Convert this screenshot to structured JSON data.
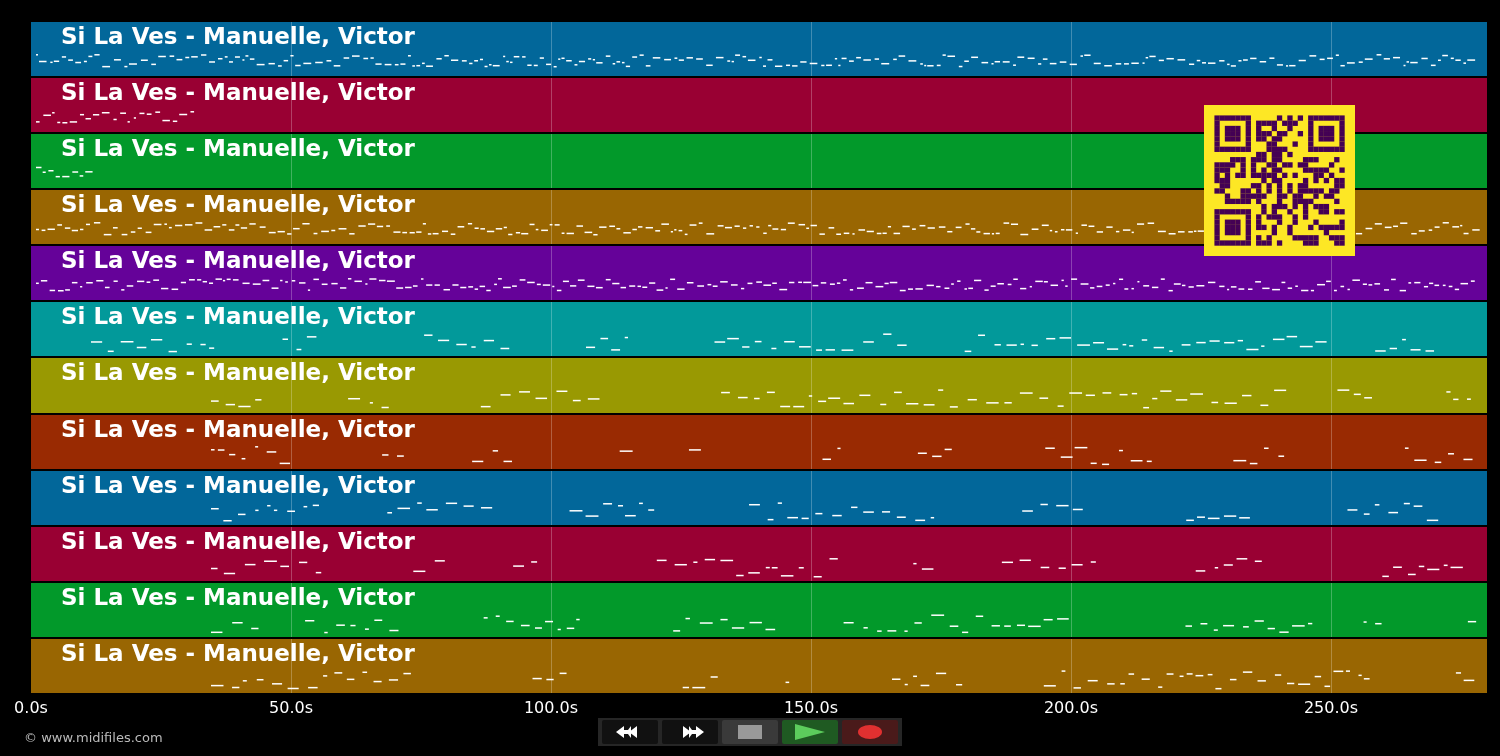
{
  "tracks": [
    {
      "label": "Si La Ves - Manuelle, Victor",
      "color": "#02679a"
    },
    {
      "label": "Si La Ves - Manuelle, Victor",
      "color": "#990033"
    },
    {
      "label": "Si La Ves - Manuelle, Victor",
      "color": "#02992a"
    },
    {
      "label": "Si La Ves - Manuelle, Victor",
      "color": "#996602"
    },
    {
      "label": "Si La Ves - Manuelle, Victor",
      "color": "#650299"
    },
    {
      "label": "Si La Ves - Manuelle, Victor",
      "color": "#02999a"
    },
    {
      "label": "Si La Ves - Manuelle, Victor",
      "color": "#999902"
    },
    {
      "label": "Si La Ves - Manuelle, Victor",
      "color": "#992a02"
    },
    {
      "label": "Si La Ves - Manuelle, Victor",
      "color": "#02679a"
    },
    {
      "label": "Si La Ves - Manuelle, Victor",
      "color": "#990033"
    },
    {
      "label": "Si La Ves - Manuelle, Victor",
      "color": "#02992a"
    },
    {
      "label": "Si La Ves - Manuelle, Victor",
      "color": "#996602"
    }
  ],
  "axis": {
    "ticks": [
      "0.0s",
      "50.0s",
      "100.0s",
      "150.0s",
      "200.0s",
      "250.0s"
    ]
  },
  "transport": [
    {
      "kind": "rewind"
    },
    {
      "kind": "forward"
    },
    {
      "kind": "stop"
    },
    {
      "kind": "play"
    },
    {
      "kind": "record"
    }
  ],
  "footer": "© www.midifiles.com"
}
